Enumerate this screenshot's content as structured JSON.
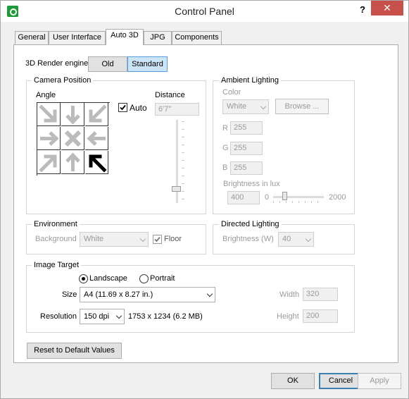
{
  "window": {
    "title": "Control Panel",
    "help": "?",
    "close": "✕"
  },
  "tabs": [
    {
      "label": "General"
    },
    {
      "label": "User Interface"
    },
    {
      "label": "Auto 3D"
    },
    {
      "label": "JPG"
    },
    {
      "label": "Components"
    }
  ],
  "active_tab": "Auto 3D",
  "render_engine": {
    "label": "3D Render engine",
    "options": [
      "Old",
      "Standard"
    ],
    "selected": "Standard"
  },
  "camera": {
    "title": "Camera Position",
    "angle_label": "Angle",
    "auto_label": "Auto",
    "auto_checked": true,
    "distance_label": "Distance",
    "distance_value": "6'7\"",
    "selected_angle": "bottom-right"
  },
  "ambient": {
    "title": "Ambient Lighting",
    "color_label": "Color",
    "color_value": "White",
    "browse_label": "Browse ...",
    "r_label": "R",
    "r_value": "255",
    "g_label": "G",
    "g_value": "255",
    "b_label": "B",
    "b_value": "255",
    "brightness_label": "Brightness in lux",
    "brightness_value": "400",
    "slider_min": "0",
    "slider_max": "2000",
    "slider_fraction": 0.2
  },
  "environment": {
    "title": "Environment",
    "background_label": "Background",
    "background_value": "White",
    "floor_label": "Floor",
    "floor_checked": true
  },
  "directed": {
    "title": "Directed Lighting",
    "brightness_label": "Brightness (W)",
    "brightness_value": "40"
  },
  "image_target": {
    "title": "Image Target",
    "landscape_label": "Landscape",
    "portrait_label": "Portrait",
    "orientation": "Landscape",
    "size_label": "Size",
    "size_value": "A4 (11.69 x 8.27 in.)",
    "resolution_label": "Resolution",
    "resolution_value": "150 dpi",
    "resolution_info": "1753 x 1234 (6.2 MB)",
    "width_label": "Width",
    "width_value": "320",
    "height_label": "Height",
    "height_value": "200"
  },
  "reset_label": "Reset to Default Values",
  "footer": {
    "ok": "OK",
    "cancel": "Cancel",
    "apply": "Apply"
  }
}
